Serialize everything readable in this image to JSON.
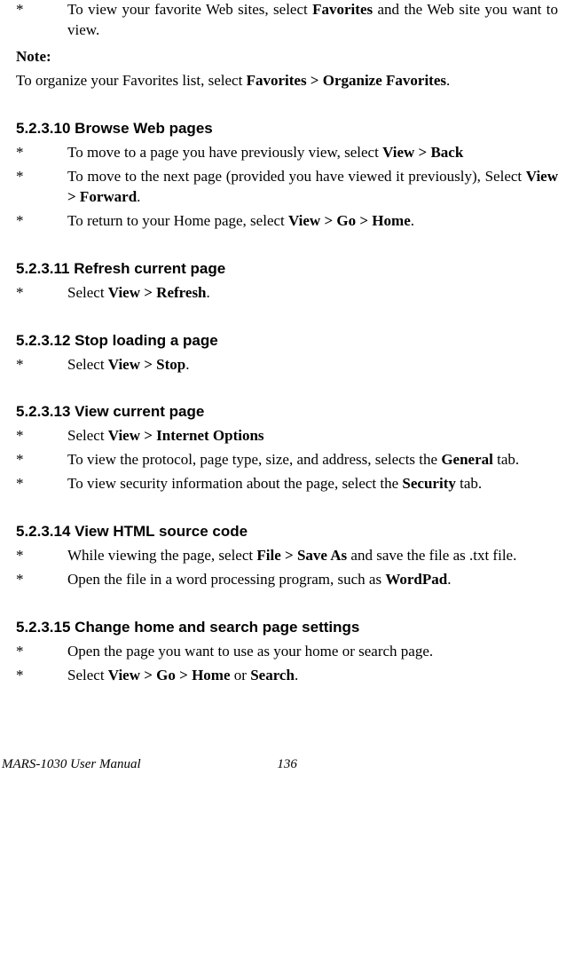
{
  "intro_items": [
    {
      "text_before": "To view your favorite Web sites, select ",
      "bold1": "Favorites",
      "text_after": " and the Web site you want to view."
    }
  ],
  "note": {
    "label": "Note:",
    "line1_before": "To organize your Favorites list, select ",
    "line1_bold": "Favorites > Organize Favorites",
    "line1_after": "."
  },
  "sections": [
    {
      "heading": "5.2.3.10 Browse Web pages",
      "items": [
        {
          "t1": "To move to a page you have previously view, select ",
          "b1": "View > Back",
          "t2": ""
        },
        {
          "t1": "To move to the next page (provided you have viewed it previously), Select ",
          "b1": "View > Forward",
          "t2": "."
        },
        {
          "t1": "To return to your Home page, select ",
          "b1": "View > Go > Home",
          "t2": "."
        }
      ]
    },
    {
      "heading": "5.2.3.11 Refresh current page",
      "items": [
        {
          "t1": "Select ",
          "b1": "View > Refresh",
          "t2": "."
        }
      ]
    },
    {
      "heading": "5.2.3.12 Stop loading a page",
      "items": [
        {
          "t1": "Select ",
          "b1": "View > Stop",
          "t2": "."
        }
      ]
    },
    {
      "heading": "5.2.3.13 View current page",
      "items": [
        {
          "t1": "Select ",
          "b1": "View > Internet Options",
          "t2": ""
        },
        {
          "t1": "To view the protocol, page type, size, and address, selects the ",
          "b1": "General",
          "t2": " tab."
        },
        {
          "t1": "To view security information about the page, select the ",
          "b1": "Security",
          "t2": " tab."
        }
      ]
    },
    {
      "heading": "5.2.3.14 View HTML source code",
      "items": [
        {
          "t1": "While viewing the page, select ",
          "b1": "File > Save As",
          "t2": " and save the file as .txt file."
        },
        {
          "t1": "Open the file in a word processing program, such as ",
          "b1": "WordPad",
          "t2": "."
        }
      ]
    },
    {
      "heading": "5.2.3.15 Change home and search page settings",
      "items": [
        {
          "t1": "Open the page you want to use as your home or search page.",
          "b1": "",
          "t2": ""
        },
        {
          "t1": "Select ",
          "b1": "View > Go > Home",
          "t2": " or ",
          "b2": "Search",
          "t3": "."
        }
      ]
    }
  ],
  "footer": {
    "title": "MARS-1030 User Manual",
    "page": "136"
  },
  "bullet_char": "*"
}
